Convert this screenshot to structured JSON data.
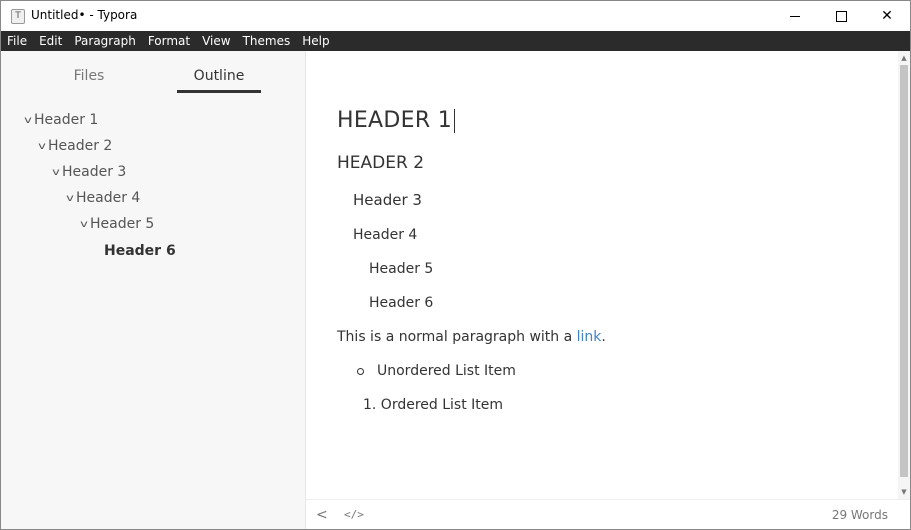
{
  "window": {
    "title": "Untitled• - Typora",
    "app_icon_letter": "T"
  },
  "menu": [
    "File",
    "Edit",
    "Paragraph",
    "Format",
    "View",
    "Themes",
    "Help"
  ],
  "sidebar": {
    "tabs": {
      "files": "Files",
      "outline": "Outline"
    },
    "active_tab": "Outline",
    "outline": [
      {
        "label": "Header 1",
        "level": 1,
        "collapsible": true
      },
      {
        "label": "Header 2",
        "level": 2,
        "collapsible": true
      },
      {
        "label": "Header 3",
        "level": 3,
        "collapsible": true
      },
      {
        "label": "Header 4",
        "level": 4,
        "collapsible": true
      },
      {
        "label": "Header 5",
        "level": 5,
        "collapsible": true
      },
      {
        "label": "Header 6",
        "level": 6,
        "collapsible": false,
        "active": true
      }
    ]
  },
  "editor": {
    "h1": "HEADER 1",
    "h2": "HEADER 2",
    "h3": "Header 3",
    "h4": "Header 4",
    "h5": "Header 5",
    "h6": "Header 6",
    "paragraph_text": "This is a normal paragraph with a ",
    "paragraph_link": "link",
    "paragraph_end": ".",
    "ul_item": "Unordered List Item",
    "ol_item": "1. Ordered List Item"
  },
  "footer": {
    "word_count": "29 Words"
  },
  "colors": {
    "menubar": "#2b2b2b",
    "sidebar_bg": "#f7f7f7",
    "link": "#4183c4"
  }
}
